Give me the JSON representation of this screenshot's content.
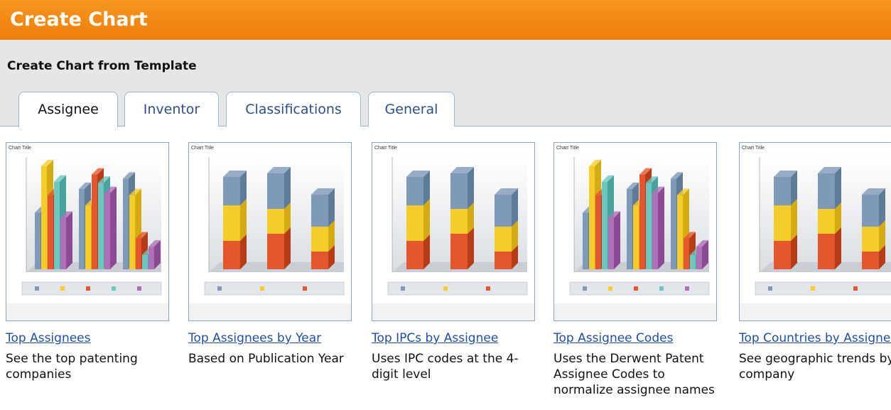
{
  "header": {
    "title": "Create Chart"
  },
  "subtitle": "Create Chart from Template",
  "tabs": [
    {
      "label": "Assignee",
      "active": true
    },
    {
      "label": "Inventor",
      "active": false
    },
    {
      "label": "Classifications",
      "active": false
    },
    {
      "label": "General",
      "active": false
    }
  ],
  "cards": [
    {
      "link": "Top Assignees",
      "desc": "See the top patenting companies",
      "thumbnail": "grouped-3d-bar",
      "thumb_title": "Chart Title"
    },
    {
      "link": "Top Assignees by Year",
      "desc": "Based on Publication Year",
      "thumbnail": "stacked-3d-bar",
      "thumb_title": "Chart Title"
    },
    {
      "link": "Top IPCs by Assignee",
      "desc": "Uses IPC codes at the 4-digit level",
      "thumbnail": "stacked-3d-bar",
      "thumb_title": "Chart Title"
    },
    {
      "link": "Top Assignee Codes",
      "desc": "Uses the Derwent Patent Assignee Codes to normalize assignee names",
      "thumbnail": "grouped-3d-bar",
      "thumb_title": "Chart Title"
    },
    {
      "link": "Top Countries by Assignee",
      "desc": "See geographic trends by company",
      "thumbnail": "stacked-3d-bar",
      "thumb_title": "Chart Title"
    }
  ],
  "colors": {
    "header": "#f7951f",
    "link": "#1e4fa6",
    "tab_border": "#9db4cf"
  }
}
